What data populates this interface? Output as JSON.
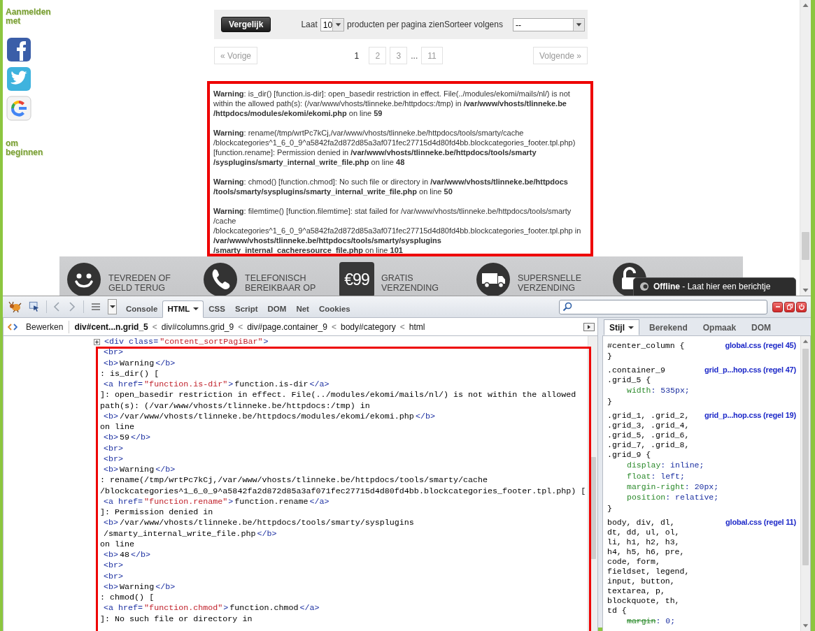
{
  "sidebar": {
    "login_label": "Aanmelden met",
    "social": [
      {
        "kind": "facebook"
      },
      {
        "kind": "twitter"
      },
      {
        "kind": "google"
      }
    ],
    "footer_label": "om beginnen"
  },
  "toolbar": {
    "compare_button": "Vergelijk",
    "show_prefix": "Laat",
    "per_page": "10",
    "show_suffix": "producten per pagina zien",
    "sort_label": "Sorteer volgens",
    "sort_value": "--"
  },
  "pagination": {
    "prev": "« Vorige",
    "next": "Volgende »",
    "pages": [
      {
        "kind": "page",
        "label": "1",
        "selected": true
      },
      {
        "kind": "page",
        "label": "2",
        "selected": false
      },
      {
        "kind": "page",
        "label": "3",
        "selected": false
      },
      {
        "kind": "ellipsis",
        "label": "...",
        "selected": false
      },
      {
        "kind": "page",
        "label": "11",
        "selected": false
      }
    ]
  },
  "warnings": {
    "highlighted": true,
    "items": [
      {
        "lines": [
          "**Warning**: is_dir() [function.is-dir]: open_basedir restriction in effect. File(../modules/ekomi/mails/nl/) is not",
          "within the allowed path(s): (/var/www/vhosts/tlinneke.be/httpdocs:/tmp) in **/var/www/vhosts/tlinneke.be**",
          "**/httpdocs/modules/ekomi/ekomi.php** on line **59**"
        ]
      },
      {
        "lines": [
          "**Warning**: rename(/tmp/wrtPc7kCj,/var/www/vhosts/tlinneke.be/httpdocs/tools/smarty/cache",
          "/blockcategories^1_6_0_9^a5842fa2d872d85a3af071fec27715d4d80fd4bb.blockcategories_footer.tpl.php)",
          "[function.rename]: Permission denied in **/var/www/vhosts/tlinneke.be/httpdocs/tools/smarty**",
          "**/sysplugins/smarty_internal_write_file.php** on line **48**"
        ]
      },
      {
        "lines": [
          "**Warning**: chmod() [function.chmod]: No such file or directory in **/var/www/vhosts/tlinneke.be/httpdocs**",
          "**/tools/smarty/sysplugins/smarty_internal_write_file.php** on line **50**"
        ]
      },
      {
        "lines": [
          "**Warning**: filemtime() [function.filemtime]: stat failed for /var/www/vhosts/tlinneke.be/httpdocs/tools/smarty",
          "/cache",
          "/blockcategories^1_6_0_9^a5842fa2d872d85a3af071fec27715d4d80fd4bb.blockcategories_footer.tpl.php in",
          "**/var/www/vhosts/tlinneke.be/httpdocs/tools/smarty/sysplugins**",
          "**/smarty_internal_cacheresource_file.php** on line **101**"
        ]
      }
    ]
  },
  "banner": [
    {
      "kind": "smiley",
      "lines": [
        "TEVREDEN OF",
        "GELD TERUG"
      ]
    },
    {
      "kind": "phone",
      "lines": [
        "TELEFONISCH",
        "BEREIKBAAR OP"
      ]
    },
    {
      "kind": "price",
      "badge": "€99",
      "lines": [
        "GRATIS",
        "VERZENDING"
      ]
    },
    {
      "kind": "truck",
      "lines": [
        "SUPERSNELLE",
        "VERZENDING"
      ]
    },
    {
      "kind": "lock"
    }
  ],
  "chat": {
    "status": "Offline",
    "message": "- Laat hier een berichtje"
  },
  "firebug": {
    "tabs": [
      {
        "label": "Console",
        "selected": false,
        "has_menu": false
      },
      {
        "label": "HTML",
        "selected": true,
        "has_menu": true
      },
      {
        "label": "CSS",
        "selected": false,
        "has_menu": false
      },
      {
        "label": "Script",
        "selected": false,
        "has_menu": false
      },
      {
        "label": "DOM",
        "selected": false,
        "has_menu": false
      },
      {
        "label": "Net",
        "selected": false,
        "has_menu": false
      },
      {
        "label": "Cookies",
        "selected": false,
        "has_menu": false
      }
    ],
    "breadcrumb": {
      "edit": "Bewerken",
      "separator": "<",
      "items": [
        {
          "label": "div#cent...n.grid_5",
          "selected": true
        },
        {
          "label": "div#columns.grid_9",
          "selected": false
        },
        {
          "label": "div#page.container_9",
          "selected": false
        },
        {
          "label": "body#category",
          "selected": false
        },
        {
          "label": "html",
          "selected": false
        }
      ]
    },
    "side_tabs": [
      {
        "label": "Stijl",
        "selected": true,
        "has_menu": true
      },
      {
        "label": "Berekend",
        "selected": false,
        "has_menu": false
      },
      {
        "label": "Opmaak",
        "selected": false,
        "has_menu": false
      },
      {
        "label": "DOM",
        "selected": false,
        "has_menu": false
      }
    ],
    "html_panel": {
      "highlighted": true,
      "parent_node": {
        "expanded": false,
        "parts": [
          {
            "kind": "tag",
            "text": "<div class="
          },
          {
            "kind": "val",
            "text": "\"content_sortPagiBar\""
          },
          {
            "kind": "tag",
            "text": ">"
          }
        ]
      },
      "lines": [
        {
          "kind": "node",
          "parts": [
            {
              "kind": "tag",
              "text": "<br>"
            }
          ]
        },
        {
          "kind": "node",
          "parts": [
            {
              "kind": "tag",
              "text": "<b>"
            },
            {
              "kind": "text",
              "text": "Warning"
            },
            {
              "kind": "tag",
              "text": "</b>"
            }
          ]
        },
        {
          "kind": "text",
          "parts": [
            {
              "kind": "text",
              "text": ": is_dir() ["
            }
          ]
        },
        {
          "kind": "node",
          "parts": [
            {
              "kind": "tag",
              "text": "<a href="
            },
            {
              "kind": "val",
              "text": "\"function.is-dir\""
            },
            {
              "kind": "tag",
              "text": ">"
            },
            {
              "kind": "text",
              "text": "function.is-dir"
            },
            {
              "kind": "tag",
              "text": "</a>"
            }
          ]
        },
        {
          "kind": "text",
          "parts": [
            {
              "kind": "text",
              "text": "]: open_basedir restriction in effect. File(../modules/ekomi/mails/nl/) is not within the allowed"
            }
          ]
        },
        {
          "kind": "text",
          "parts": [
            {
              "kind": "text",
              "text": "path(s): (/var/www/vhosts/tlinneke.be/httpdocs:/tmp) in"
            }
          ]
        },
        {
          "kind": "node",
          "parts": [
            {
              "kind": "tag",
              "text": "<b>"
            },
            {
              "kind": "text",
              "text": "/var/www/vhosts/tlinneke.be/httpdocs/modules/ekomi/ekomi.php"
            },
            {
              "kind": "tag",
              "text": "</b>"
            }
          ]
        },
        {
          "kind": "text",
          "parts": [
            {
              "kind": "text",
              "text": "on line"
            }
          ]
        },
        {
          "kind": "node",
          "parts": [
            {
              "kind": "tag",
              "text": "<b>"
            },
            {
              "kind": "text",
              "text": "59"
            },
            {
              "kind": "tag",
              "text": "</b>"
            }
          ]
        },
        {
          "kind": "node",
          "parts": [
            {
              "kind": "tag",
              "text": "<br>"
            }
          ]
        },
        {
          "kind": "node",
          "parts": [
            {
              "kind": "tag",
              "text": "<br>"
            }
          ]
        },
        {
          "kind": "node",
          "parts": [
            {
              "kind": "tag",
              "text": "<b>"
            },
            {
              "kind": "text",
              "text": "Warning"
            },
            {
              "kind": "tag",
              "text": "</b>"
            }
          ]
        },
        {
          "kind": "text",
          "parts": [
            {
              "kind": "text",
              "text": ": rename(/tmp/wrtPc7kCj,/var/www/vhosts/tlinneke.be/httpdocs/tools/smarty/cache"
            }
          ]
        },
        {
          "kind": "text",
          "parts": [
            {
              "kind": "text",
              "text": "/blockcategories^1_6_0_9^a5842fa2d872d85a3af071fec27715d4d80fd4bb.blockcategories_footer.tpl.php) ["
            }
          ]
        },
        {
          "kind": "node",
          "parts": [
            {
              "kind": "tag",
              "text": "<a href="
            },
            {
              "kind": "val",
              "text": "\"function.rename\""
            },
            {
              "kind": "tag",
              "text": ">"
            },
            {
              "kind": "text",
              "text": "function.rename"
            },
            {
              "kind": "tag",
              "text": "</a>"
            }
          ]
        },
        {
          "kind": "text",
          "parts": [
            {
              "kind": "text",
              "text": "]: Permission denied in"
            }
          ]
        },
        {
          "kind": "node",
          "parts": [
            {
              "kind": "tag",
              "text": "<b>"
            },
            {
              "kind": "text",
              "text": "/var/www/vhosts/tlinneke.be/httpdocs/tools/smarty/sysplugins"
            }
          ]
        },
        {
          "kind": "node",
          "parts": [
            {
              "kind": "text",
              "text": "/smarty_internal_write_file.php"
            },
            {
              "kind": "tag",
              "text": "</b>"
            }
          ]
        },
        {
          "kind": "text",
          "parts": [
            {
              "kind": "text",
              "text": "on line"
            }
          ]
        },
        {
          "kind": "node",
          "parts": [
            {
              "kind": "tag",
              "text": "<b>"
            },
            {
              "kind": "text",
              "text": "48"
            },
            {
              "kind": "tag",
              "text": "</b>"
            }
          ]
        },
        {
          "kind": "node",
          "parts": [
            {
              "kind": "tag",
              "text": "<br>"
            }
          ]
        },
        {
          "kind": "node",
          "parts": [
            {
              "kind": "tag",
              "text": "<br>"
            }
          ]
        },
        {
          "kind": "node",
          "parts": [
            {
              "kind": "tag",
              "text": "<b>"
            },
            {
              "kind": "text",
              "text": "Warning"
            },
            {
              "kind": "tag",
              "text": "</b>"
            }
          ]
        },
        {
          "kind": "text",
          "parts": [
            {
              "kind": "text",
              "text": ": chmod() ["
            }
          ]
        },
        {
          "kind": "node",
          "parts": [
            {
              "kind": "tag",
              "text": "<a href="
            },
            {
              "kind": "val",
              "text": "\"function.chmod\""
            },
            {
              "kind": "tag",
              "text": ">"
            },
            {
              "kind": "text",
              "text": "function.chmod"
            },
            {
              "kind": "tag",
              "text": "</a>"
            }
          ]
        },
        {
          "kind": "text",
          "parts": [
            {
              "kind": "text",
              "text": "]: No such file or directory in"
            }
          ]
        }
      ]
    },
    "css_panel": {
      "rules": [
        {
          "selectors": [
            "#center_column {"
          ],
          "source": "global.css (regel 45)",
          "close": "}"
        },
        {
          "selectors": [
            ".container_9",
            ".grid_5 {"
          ],
          "source": "grid_p...hop.css (regel 47)",
          "props": [
            {
              "name": "width",
              "value": ": 535px;",
              "overridden": false
            }
          ],
          "close": "}"
        },
        {
          "selectors": [
            ".grid_1, .grid_2,",
            ".grid_3, .grid_4,",
            ".grid_5, .grid_6,",
            ".grid_7, .grid_8,",
            ".grid_9 {"
          ],
          "source": "grid_p...hop.css (regel 19)",
          "props": [
            {
              "name": "display",
              "value": ": inline;",
              "overridden": false
            },
            {
              "name": "float",
              "value": ": left;",
              "overridden": false
            },
            {
              "name": "margin-right",
              "value": ": 20px;",
              "overridden": false
            },
            {
              "name": "position",
              "value": ": relative;",
              "overridden": false
            }
          ],
          "close": "}"
        },
        {
          "selectors": [
            "body, div, dl,",
            "dt, dd, ul, ol,",
            "li, h1, h2, h3,",
            "h4, h5, h6, pre,",
            "code, form,",
            "fieldset, legend,",
            "input, button,",
            "textarea, p,",
            "blockquote, th,",
            "td {"
          ],
          "source": "global.css (regel 11)",
          "props": [
            {
              "name": "margin",
              "value": ": 0;",
              "overridden": true
            }
          ]
        }
      ]
    }
  }
}
